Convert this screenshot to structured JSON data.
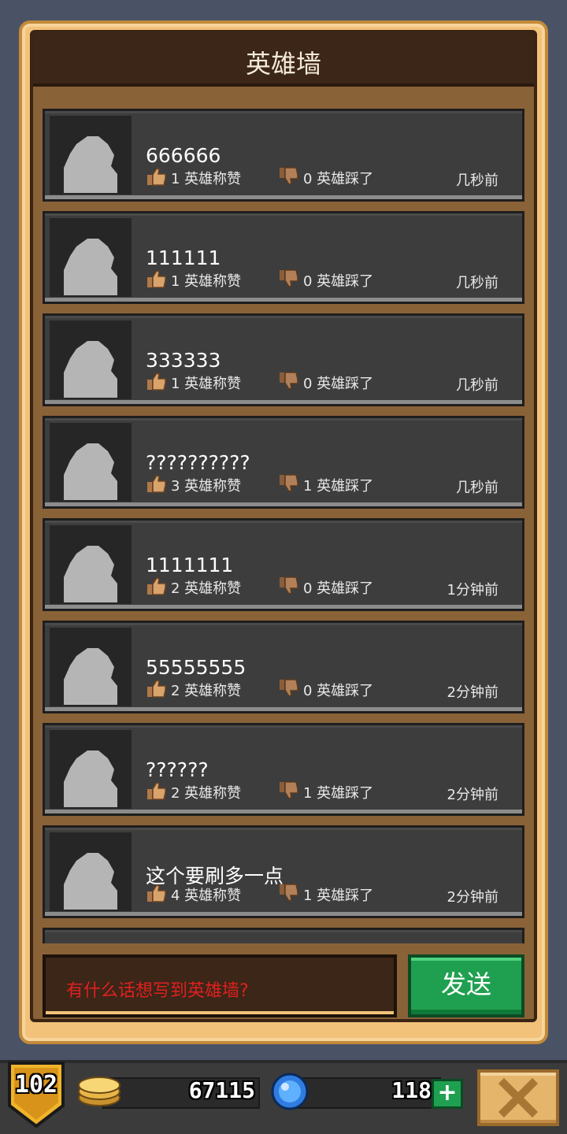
{
  "header": {
    "title": "英雄墙"
  },
  "posts": [
    {
      "message": "666666",
      "likes": "1 英雄称赞",
      "dislikes": "0 英雄踩了",
      "time": "几秒前"
    },
    {
      "message": "111111",
      "likes": "1 英雄称赞",
      "dislikes": "0 英雄踩了",
      "time": "几秒前"
    },
    {
      "message": "333333",
      "likes": "1 英雄称赞",
      "dislikes": "0 英雄踩了",
      "time": "几秒前"
    },
    {
      "message": "??????????",
      "likes": "3 英雄称赞",
      "dislikes": "1 英雄踩了",
      "time": "几秒前"
    },
    {
      "message": "1111111",
      "likes": "2 英雄称赞",
      "dislikes": "0 英雄踩了",
      "time": "1分钟前"
    },
    {
      "message": "55555555",
      "likes": "2 英雄称赞",
      "dislikes": "0 英雄踩了",
      "time": "2分钟前"
    },
    {
      "message": "??????",
      "likes": "2 英雄称赞",
      "dislikes": "1 英雄踩了",
      "time": "2分钟前"
    },
    {
      "message": "这个要刷多一点",
      "likes": "4 英雄称赞",
      "dislikes": "1 英雄踩了",
      "time": "2分钟前"
    }
  ],
  "composer": {
    "placeholder": "有什么话想写到英雄墙?",
    "send_label": "发送"
  },
  "status_bar": {
    "level": "102",
    "coins": "67115",
    "gems": "118",
    "add_label": "+"
  },
  "colors": {
    "frame": "#f2c27a",
    "panel": "#8a6238",
    "title_bar": "#3c2617",
    "card": "#3d3d3d",
    "send": "#1fa050",
    "placeholder": "#e02020"
  }
}
